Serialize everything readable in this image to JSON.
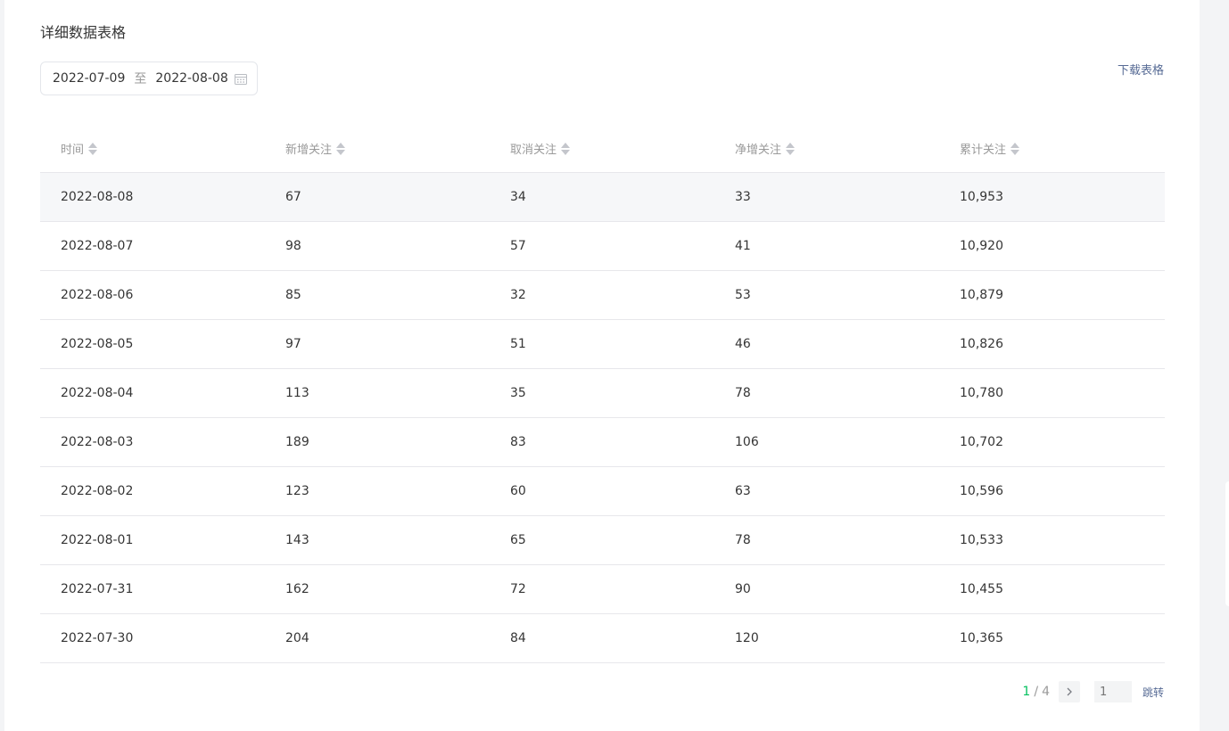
{
  "section": {
    "title": "详细数据表格",
    "download_label": "下载表格"
  },
  "date_range": {
    "start": "2022-07-09",
    "separator": "至",
    "end": "2022-08-08",
    "icon": "calendar-icon"
  },
  "table": {
    "columns": [
      "时间",
      "新增关注",
      "取消关注",
      "净增关注",
      "累计关注"
    ],
    "rows": [
      [
        "2022-08-08",
        "67",
        "34",
        "33",
        "10,953"
      ],
      [
        "2022-08-07",
        "98",
        "57",
        "41",
        "10,920"
      ],
      [
        "2022-08-06",
        "85",
        "32",
        "53",
        "10,879"
      ],
      [
        "2022-08-05",
        "97",
        "51",
        "46",
        "10,826"
      ],
      [
        "2022-08-04",
        "113",
        "35",
        "78",
        "10,780"
      ],
      [
        "2022-08-03",
        "189",
        "83",
        "106",
        "10,702"
      ],
      [
        "2022-08-02",
        "123",
        "60",
        "63",
        "10,596"
      ],
      [
        "2022-08-01",
        "143",
        "65",
        "78",
        "10,533"
      ],
      [
        "2022-07-31",
        "162",
        "72",
        "90",
        "10,455"
      ],
      [
        "2022-07-30",
        "204",
        "84",
        "120",
        "10,365"
      ]
    ]
  },
  "pagination": {
    "current": "1",
    "separator": "/",
    "total": "4",
    "input_placeholder": "1",
    "jump_label": "跳转"
  },
  "colors": {
    "accent_green": "#07c160",
    "link_blue": "#576b95",
    "row_highlight": "#f6f7f9"
  }
}
